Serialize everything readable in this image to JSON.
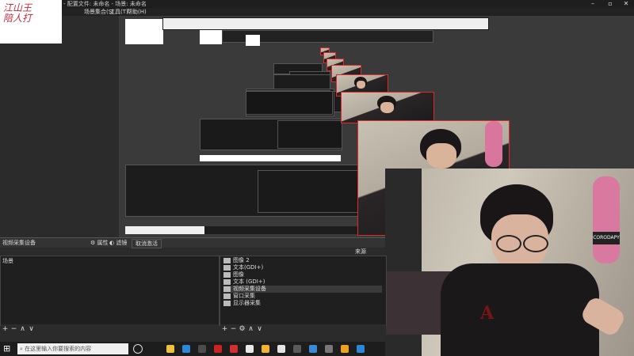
{
  "window": {
    "title": "- 配置文件: 未命名 - 场景: 未命名"
  },
  "menu": {
    "items": [
      "场景集合(S)",
      "工具(T)",
      "帮助(H)"
    ]
  },
  "logo": {
    "text": "江山王\n陪人打"
  },
  "source_bar": {
    "source_name": "视频采集设备",
    "properties_label": "属性",
    "filters_label": "滤镜",
    "refresh_label": "取消激活"
  },
  "scenes_dock": {
    "header": "场景",
    "tools": [
      "+",
      "−",
      "∧",
      "∨"
    ]
  },
  "sources_dock": {
    "header": "来源",
    "items": [
      {
        "icon": "image-icon",
        "label": "图像 2",
        "selected": false
      },
      {
        "icon": "text-icon",
        "label": "文本(GDI+)",
        "selected": false
      },
      {
        "icon": "image-icon",
        "label": "图像",
        "selected": false
      },
      {
        "icon": "text-icon",
        "label": "文本 (GDI+)",
        "selected": false
      },
      {
        "icon": "camera-icon",
        "label": "视频采集设备",
        "selected": true
      },
      {
        "icon": "window-icon",
        "label": "窗口采集",
        "selected": false
      },
      {
        "icon": "monitor-icon",
        "label": "显示器采集",
        "selected": false
      }
    ],
    "tools": [
      "+",
      "−",
      "⚙",
      "∧",
      "∨"
    ]
  },
  "taskbar": {
    "search_placeholder": "在这里输入你要搜索的内容",
    "colors": [
      "#f0c040",
      "#2b88d8",
      "#4c4c4c",
      "#c22",
      "#d03030",
      "#e8e8e8",
      "#f2b233",
      "#e3e3e3",
      "#5a5a5a",
      "#3a8ad8",
      "#777",
      "#f0a020",
      "#2b88d8"
    ]
  },
  "colors": {
    "selection_border": "#e02a2a",
    "panel_bg": "#1f1f1f",
    "app_bg": "#2b2b2b"
  }
}
